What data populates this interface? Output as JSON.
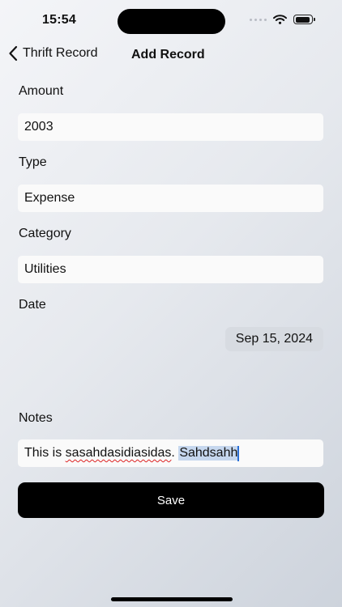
{
  "status_bar": {
    "time": "15:54"
  },
  "nav": {
    "back_label": "Thrift Record",
    "title": "Add Record"
  },
  "form": {
    "amount_label": "Amount",
    "amount_value": "2003",
    "type_label": "Type",
    "type_value": "Expense",
    "category_label": "Category",
    "category_value": "Utilities",
    "date_label": "Date",
    "date_value": "Sep 15, 2024",
    "notes_label": "Notes",
    "notes_prefix": "This is ",
    "notes_misspelled": "sasahdasidiasidas",
    "notes_separator": ". ",
    "notes_selected": "Sahdsahh"
  },
  "actions": {
    "save_label": "Save"
  },
  "colors": {
    "accent": "#000000",
    "selection": "#c6d7ee",
    "field_bg": "#fafafa"
  }
}
